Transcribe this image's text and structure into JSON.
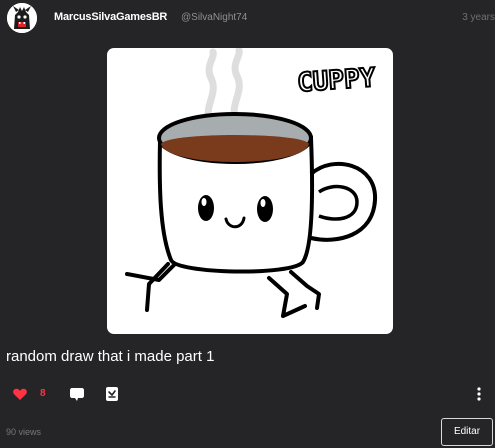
{
  "post": {
    "author": {
      "display_name": "MarcusSilvaGamesBR",
      "handle": "@SilvaNight74",
      "avatar_icon": "character-avatar"
    },
    "time_ago": "3 years",
    "artwork": {
      "drawn_label": "CUPPY",
      "description_icon": "coffee-cup-drawing"
    },
    "title": "random draw that i made part 1",
    "actions": {
      "like_icon": "heart-icon",
      "like_count": "8",
      "like_color": "#ff3344",
      "comment_icon": "comment-icon",
      "remix_icon": "remix-icon",
      "more_icon": "more-vertical-icon"
    },
    "views": "90 views",
    "edit_label": "Editar"
  },
  "colors": {
    "background": "#252527",
    "text": "#ffffff",
    "muted": "#8f8f94",
    "accent_like": "#ff3344"
  }
}
